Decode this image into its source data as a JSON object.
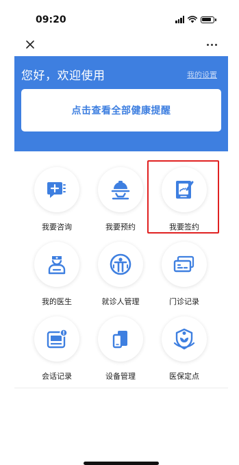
{
  "status_bar": {
    "time": "09:20"
  },
  "nav": {
    "close_icon": "close-icon",
    "more_icon": "more-icon"
  },
  "header": {
    "greeting": "您好，欢迎使用",
    "settings_link": "我的设置",
    "reminder_button": "点击查看全部健康提醒",
    "background_color": "#3e7fe0"
  },
  "grid": {
    "items": [
      {
        "label": "我要咨询",
        "icon": "chat-icon"
      },
      {
        "label": "我要预约",
        "icon": "service-bell-icon"
      },
      {
        "label": "我要签约",
        "icon": "sign-tablet-icon",
        "highlighted": true
      },
      {
        "label": "我的医生",
        "icon": "doctor-icon"
      },
      {
        "label": "就诊人管理",
        "icon": "patient-icon"
      },
      {
        "label": "门诊记录",
        "icon": "cards-icon"
      },
      {
        "label": "会话记录",
        "icon": "message-record-icon"
      },
      {
        "label": "设备管理",
        "icon": "devices-icon"
      },
      {
        "label": "医保定点",
        "icon": "insurance-icon"
      }
    ]
  },
  "colors": {
    "accent": "#3e7fe0",
    "highlight": "#e02020"
  }
}
